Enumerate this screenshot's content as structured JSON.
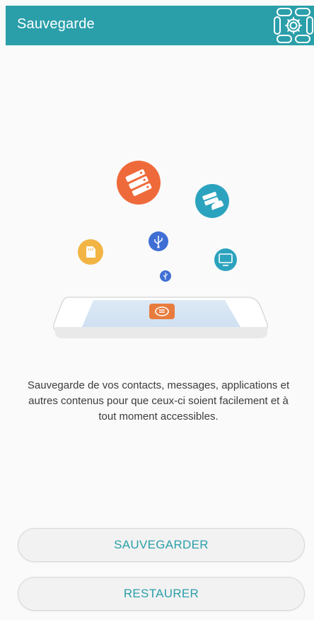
{
  "header": {
    "title": "Sauvegarde",
    "settings_icon": "gear-icon",
    "background": "#2a9faa"
  },
  "illustration": {
    "icons": [
      "server-icon",
      "cloud-server-icon",
      "sd-card-icon",
      "usb-icon",
      "monitor-icon",
      "small-usb-icon",
      "phone-backup-icon"
    ]
  },
  "main": {
    "description": "Sauvegarde de vos contacts, messages, applications et autres contenus pour que ceux-ci soient facilement et à tout moment accessibles."
  },
  "actions": {
    "backup_label": "SAUVEGARDER",
    "restore_label": "RESTAURER",
    "accent": "#2a9faa"
  }
}
